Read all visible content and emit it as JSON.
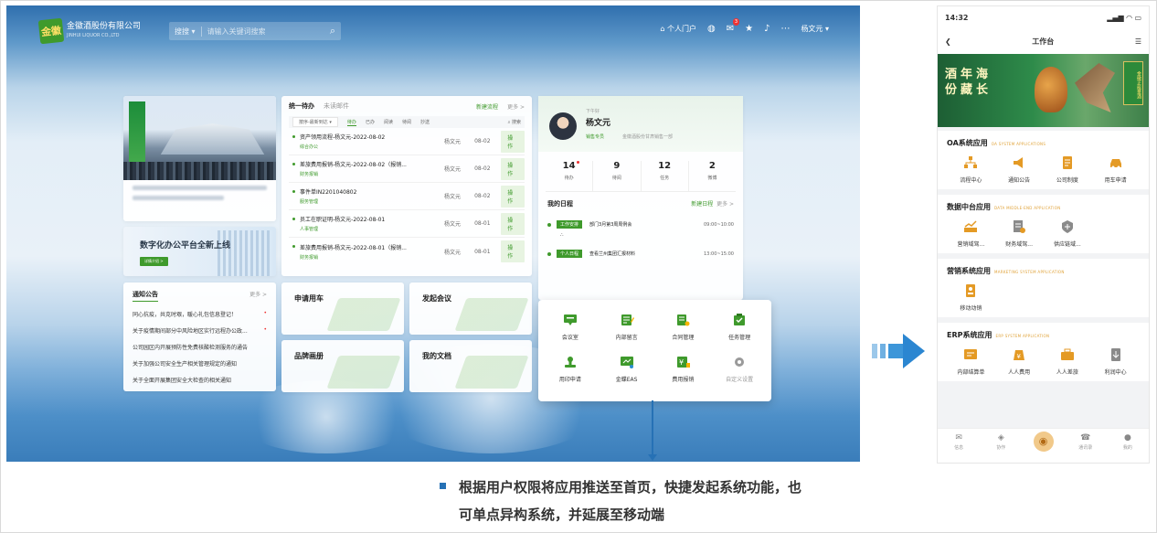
{
  "desktop": {
    "logo": {
      "mark": "金徽",
      "name": "金徽酒股份有限公司",
      "en": "JINHUI LIQUOR CO.,LTD"
    },
    "search": {
      "scope": "搜搜",
      "placeholder": "请输入关键词搜索"
    },
    "header": {
      "portal": "个人门户",
      "mail_badge": "3",
      "user": "杨文元"
    },
    "promo": {
      "title": "数字化办公平台全新上线",
      "button": "详情介绍 >"
    },
    "notice": {
      "title": "通知公告",
      "more": "更多 >",
      "items": [
        "同心抗疫，共克时艰，暖心礼包信息登记！",
        "关于疫情期间部分中风险地区实行远程办公政...",
        "公司园区内开展预防性免费核酸检测服务的通告",
        "关于加强公司安全生产相关管理规定的通知",
        "关于全面开展集团安全大检查的相关通知"
      ]
    },
    "todo": {
      "tabs": [
        "统一待办",
        "未读邮件"
      ],
      "new": "新建流程",
      "more": "更多 >",
      "filter_select": "按序-最新到达",
      "filters": [
        "待办",
        "已办",
        "阅读",
        "待阅",
        "抄送"
      ],
      "search": "搜索",
      "rows": [
        {
          "title": "资产领用流程-杨文元-2022-08-02",
          "cat": "综合办公",
          "who": "杨文元",
          "date": "08-02",
          "op": "操作"
        },
        {
          "title": "差旅费用报销-杨文元-2022-08-02（报销...",
          "cat": "财务报销",
          "who": "杨文元",
          "date": "08-02",
          "op": "操作"
        },
        {
          "title": "事件单IN2201040802",
          "cat": "服务管理",
          "who": "杨文元",
          "date": "08-02",
          "op": "操作"
        },
        {
          "title": "员工在职证明-杨文元-2022-08-01",
          "cat": "人事管理",
          "who": "杨文元",
          "date": "08-01",
          "op": "操作"
        },
        {
          "title": "差旅费用报销-杨文元-2022-08-01（报销...",
          "cat": "财务报销",
          "who": "杨文元",
          "date": "08-01",
          "op": "操作"
        }
      ]
    },
    "tiles": [
      "申请用车",
      "发起会议",
      "品牌画册",
      "我的文档"
    ],
    "user": {
      "greet": "下午好",
      "name": "杨文元",
      "dept": "销售专员",
      "org": "金徽酒股份甘肃销售一部",
      "stats": [
        {
          "n": "14",
          "l": "待办"
        },
        {
          "n": "9",
          "l": "待阅"
        },
        {
          "n": "12",
          "l": "任务"
        },
        {
          "n": "2",
          "l": "微博"
        }
      ],
      "schedule_title": "我的日程",
      "schedule_new": "新建日程",
      "schedule_more": "更多 >",
      "events": [
        {
          "tag": "工作安排",
          "title": "部门3月第3周周例会",
          "time": "09:00~10:00",
          "pin": "⛬"
        },
        {
          "tag": "个人日程",
          "title": "查看兰州集团汇报材料",
          "time": "13:00~15:00",
          "pin": "⛬"
        }
      ]
    },
    "apps": [
      {
        "label": "会议室",
        "icon": "meeting-room-icon"
      },
      {
        "label": "内部留言",
        "icon": "message-icon"
      },
      {
        "label": "合同管理",
        "icon": "contract-icon"
      },
      {
        "label": "任务管理",
        "icon": "task-icon"
      },
      {
        "label": "用印申请",
        "icon": "seal-icon"
      },
      {
        "label": "金蝶EAS",
        "icon": "kingdee-icon"
      },
      {
        "label": "费用报销",
        "icon": "expense-icon"
      },
      {
        "label": "自定义设置",
        "icon": "settings-icon"
      }
    ]
  },
  "caption": {
    "line1": "根据用户权限将应用推送至首页，快捷发起系统功能，也",
    "line2": "可单点异构系统，并延展至移动端"
  },
  "mobile": {
    "time": "14:32",
    "title": "工作台",
    "hero": {
      "slogan": "酒年海份藏长",
      "box": "金徽正能量酒"
    },
    "sections": [
      {
        "title": "OA系统应用",
        "en": "OA SYSTEM APPLICATIONS",
        "items": [
          {
            "label": "流程中心",
            "icon": "flow-icon"
          },
          {
            "label": "通知公告",
            "icon": "announce-icon"
          },
          {
            "label": "公司制度",
            "icon": "policy-icon"
          },
          {
            "label": "用车申请",
            "icon": "car-icon"
          }
        ]
      },
      {
        "title": "数据中台应用",
        "en": "DATA MIDDLE-END APPLICATION",
        "items": [
          {
            "label": "营销域驾...",
            "icon": "chart-icon"
          },
          {
            "label": "财务域驾...",
            "icon": "finance-icon"
          },
          {
            "label": "供应链域...",
            "icon": "supply-icon"
          }
        ]
      },
      {
        "title": "营销系统应用",
        "en": "MARKETING SYSTEM APPLICATION",
        "items": [
          {
            "label": "移动动销",
            "icon": "mobile-sales-icon"
          }
        ]
      },
      {
        "title": "ERP系统应用",
        "en": "ERP SYSTEM APPLICATION",
        "items": [
          {
            "label": "内部结算单",
            "icon": "settlement-icon"
          },
          {
            "label": "人人费用",
            "icon": "fee-icon"
          },
          {
            "label": "人人差旅",
            "icon": "travel-icon"
          },
          {
            "label": "利润中心",
            "icon": "profit-icon"
          }
        ]
      }
    ],
    "tabbar": [
      {
        "label": "信息",
        "icon": "chat-icon"
      },
      {
        "label": "协作",
        "icon": "collab-icon"
      },
      {
        "label": "",
        "icon": "home-icon"
      },
      {
        "label": "通讯录",
        "icon": "contacts-icon"
      },
      {
        "label": "我的",
        "icon": "profile-icon"
      }
    ]
  }
}
